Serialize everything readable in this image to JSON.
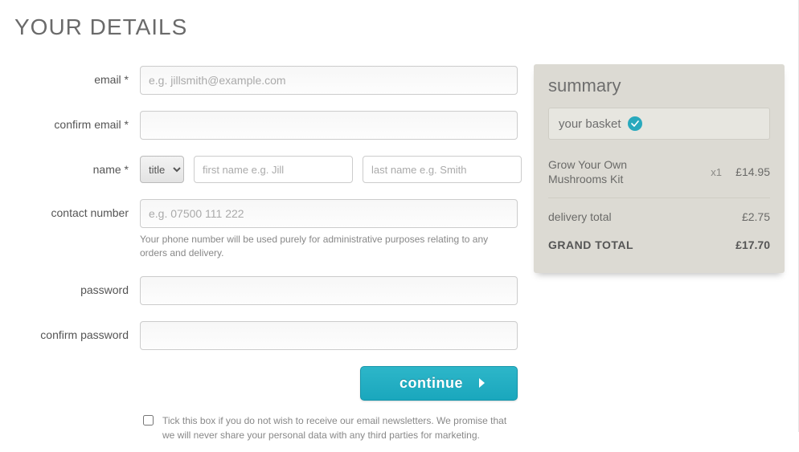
{
  "page_title": "YOUR DETAILS",
  "form": {
    "email_label": "email *",
    "email_placeholder": "e.g. jillsmith@example.com",
    "confirm_email_label": "confirm email *",
    "name_label": "name *",
    "title_option": "title",
    "first_name_placeholder": "first name e.g. Jill",
    "last_name_placeholder": "last name e.g. Smith",
    "contact_label": "contact number",
    "contact_placeholder": "e.g. 07500 111 222",
    "contact_help": "Your phone number will be used purely for administrative purposes relating to any orders and delivery.",
    "password_label": "password",
    "confirm_password_label": "confirm password",
    "continue_label": "continue",
    "optout_text": "Tick this box if you do not wish to receive our email newsletters. We promise that we will never share your personal data with any third parties for marketing."
  },
  "summary": {
    "heading": "summary",
    "basket_label": "your basket",
    "item_name": "Grow Your Own Mushrooms Kit",
    "item_qty": "x1",
    "item_price": "£14.95",
    "delivery_label": "delivery total",
    "delivery_price": "£2.75",
    "grand_label": "GRAND TOTAL",
    "grand_price": "£17.70"
  }
}
